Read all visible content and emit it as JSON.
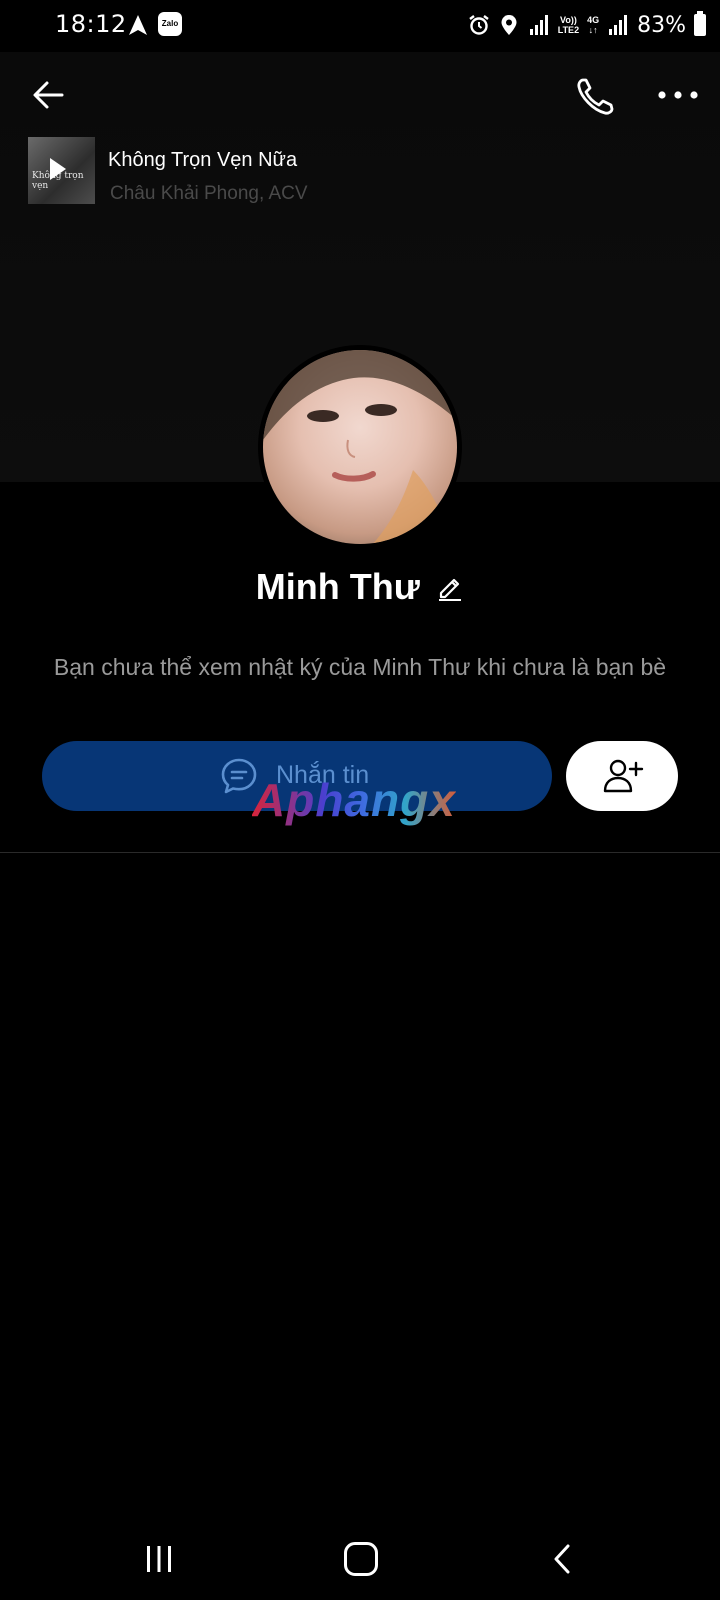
{
  "status_bar": {
    "time": "18:12",
    "zalo_label": "Zalo",
    "lte_line1": "Vo))",
    "lte_line2": "LTE2",
    "net_label": "4G",
    "battery": "83%"
  },
  "header": {
    "back_icon": "arrow-left-icon",
    "call_icon": "phone-icon",
    "more_icon": "more-horizontal-icon"
  },
  "music": {
    "thumb_text": "Không trọn vẹn",
    "title": "Không Trọn Vẹn Nữa",
    "artist": "Châu Khải Phong, ACV"
  },
  "profile": {
    "name": "Minh Thư",
    "notice": "Bạn chưa thể xem nhật ký của Minh Thư khi chưa là bạn bè"
  },
  "actions": {
    "message_label": "Nhắn tin",
    "message_icon": "chat-bubble-icon",
    "add_friend_icon": "add-user-icon"
  },
  "watermark": "Aphangx",
  "colors": {
    "background": "#000000",
    "message_button": "#073676",
    "message_text": "#5b8fcf",
    "notice_text": "#9a9a9a"
  }
}
